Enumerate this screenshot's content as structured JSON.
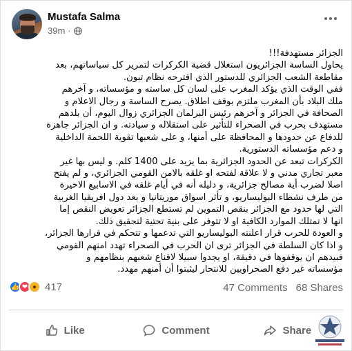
{
  "post": {
    "author": "Mustafa Salma",
    "time": "39m",
    "separator": "·",
    "audience_icon": "globe-icon",
    "more_icon": "more-options-icon",
    "lines": [
      "الجزائر مستهدفة!!!",
      "يحاول الساسة الجزائريون استغلال قضية الكركرات لتمرير كل سياساتهم، بعد",
      "مقاطعة الشعب الجزائري للدستور الذي اقترحه نظام تبون.",
      "ففي الوقت الذي يؤكد المغرب على لسان كل ساسته و مؤسساته، و آخرهم",
      "ملك البلاد بأن المغرب ملتزم بوقف اطلاق. يصرح الساسة و رجال الاعلام و",
      "الصحافة في الجزائر و آخرهم رئيس البرلمان الجزائري زوال اليوم، أن بلدهم",
      "مستهدف بحرب في الصحراء للتأثير على استقلاله و سيادته. و ان الجزائر جاهزة",
      "للدفاع عن حدودها و المحافظة على أمنها، و على شعبها تقوية اللحمة الداخلية",
      "و دعم مؤسساته الدستورية.",
      "الكركرات تبعد عن الحدود الجزائرية بما يزيد على 1400 كلم. و ليس بها غير",
      "معبر تجاري مدني و لا علاقة لفتحه او غلقه بالامن القومي الجزائري، و لم يفتح",
      "اصلا لضرب أية مصالح جزائرية، و دليله أنه في أيام غلقه في الاسابيع الاخيرة",
      "من طرف نشطاء البوليساريو، و تأثر اسواق موريتانيا و بعد دول افريقيا الغربية",
      "التي لها حدود مع الجزائر بنقص التموين لم تستطع الجزائر تعويض النقص إما",
      "انها لا تمتلك الموارد الكافية او لا تتوفر على بنية تحتية لتحقيق ذلك.",
      "و العودة للحرب قرار اعلنته البوليساريو التي تدعمها و تتحكم في قرارها الجزائر،",
      "و اذا كان السلطة في الجزائر ترى ان الحرب في الصحراء تهدد امنهم القومي",
      "فبيدهم ان يوقفوها في دقيقة، او يجدوا سبيلا لاقناع شعبهم بنظامهم و",
      "مؤسساته غير دفع الصحراويين للانتحار ليثبتوا أن أمنهم مهدد."
    ]
  },
  "stats": {
    "reaction_icons": [
      "like-reaction-icon",
      "love-reaction-icon",
      "wow-reaction-icon"
    ],
    "reaction_count": "417",
    "comments": "47 Comments",
    "shares": "68 Shares"
  },
  "actions": {
    "like": "Like",
    "comment": "Comment",
    "share": "Share"
  },
  "colors": {
    "text": "#050505",
    "secondary": "#65676b",
    "like_blue": "#1877f2",
    "love_red": "#f33e58",
    "wow_yellow": "#f7b125"
  }
}
